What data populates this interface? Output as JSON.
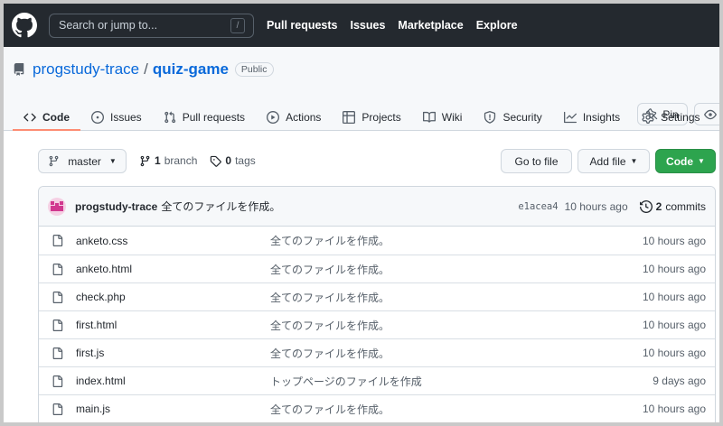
{
  "header": {
    "search_placeholder": "Search or jump to...",
    "slash_key": "/",
    "nav": [
      "Pull requests",
      "Issues",
      "Marketplace",
      "Explore"
    ]
  },
  "repo": {
    "owner": "progstudy-trace",
    "separator": "/",
    "name": "quiz-game",
    "visibility": "Public",
    "pin_label": "Pin"
  },
  "tabs": [
    {
      "label": "Code",
      "icon": "code-icon",
      "selected": true
    },
    {
      "label": "Issues",
      "icon": "issue-icon"
    },
    {
      "label": "Pull requests",
      "icon": "pull-request-icon"
    },
    {
      "label": "Actions",
      "icon": "play-icon"
    },
    {
      "label": "Projects",
      "icon": "table-icon"
    },
    {
      "label": "Wiki",
      "icon": "book-icon"
    },
    {
      "label": "Security",
      "icon": "shield-icon"
    },
    {
      "label": "Insights",
      "icon": "graph-icon"
    },
    {
      "label": "Settings",
      "icon": "gear-icon"
    }
  ],
  "filenav": {
    "branch": "master",
    "branch_count": "1",
    "branch_word": "branch",
    "tag_count": "0",
    "tag_word": "tags",
    "go_to_file": "Go to file",
    "add_file": "Add file",
    "code": "Code"
  },
  "commit": {
    "author": "progstudy-trace",
    "message": "全てのファイルを作成。",
    "sha": "e1acea4",
    "time": "10 hours ago",
    "count": "2",
    "count_word": "commits"
  },
  "files": [
    {
      "name": "anketo.css",
      "message": "全てのファイルを作成。",
      "age": "10 hours ago"
    },
    {
      "name": "anketo.html",
      "message": "全てのファイルを作成。",
      "age": "10 hours ago"
    },
    {
      "name": "check.php",
      "message": "全てのファイルを作成。",
      "age": "10 hours ago"
    },
    {
      "name": "first.html",
      "message": "全てのファイルを作成。",
      "age": "10 hours ago"
    },
    {
      "name": "first.js",
      "message": "全てのファイルを作成。",
      "age": "10 hours ago"
    },
    {
      "name": "index.html",
      "message": "トップページのファイルを作成",
      "age": "9 days ago"
    },
    {
      "name": "main.js",
      "message": "全てのファイルを作成。",
      "age": "10 hours ago"
    }
  ],
  "colors": {
    "header_bg": "#24292f",
    "link": "#0969da",
    "code_button": "#2da44e",
    "tab_underline": "#fd8c73"
  }
}
